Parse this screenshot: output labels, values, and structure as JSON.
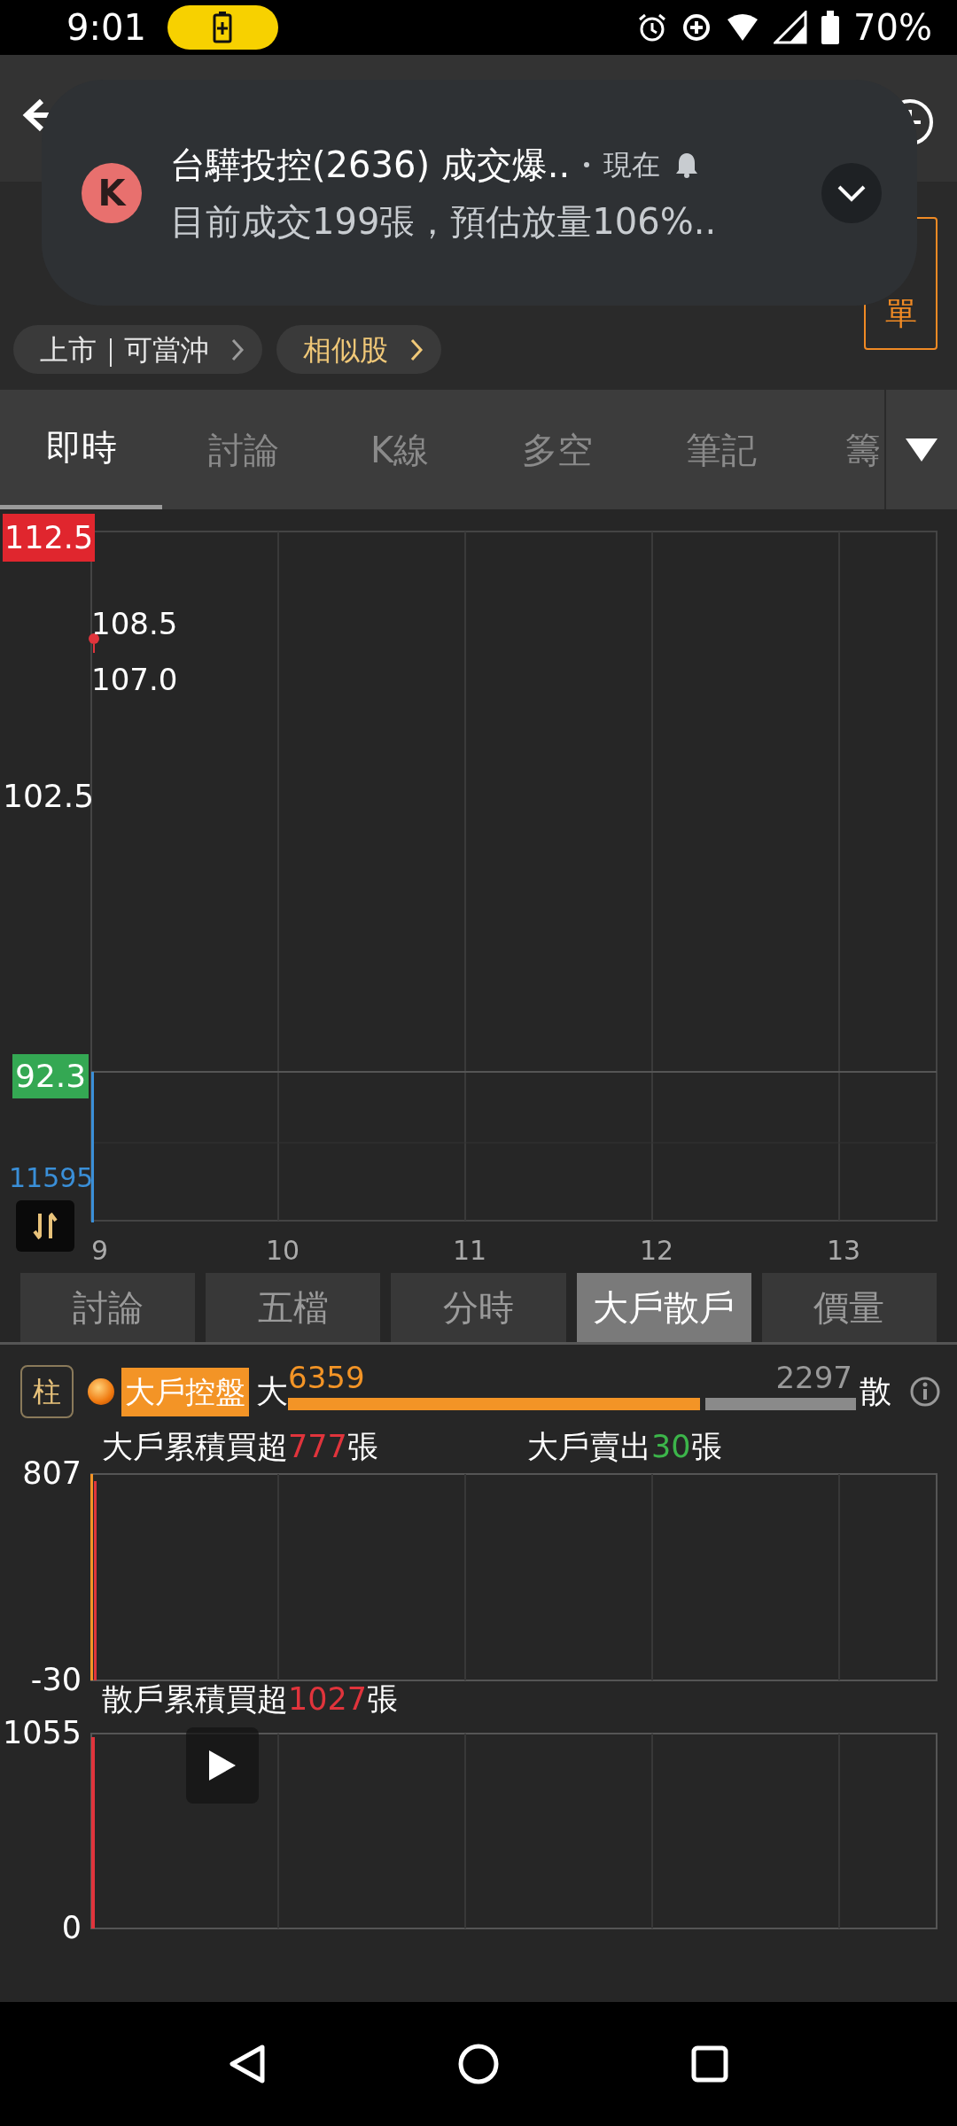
{
  "status_bar": {
    "time": "9:01",
    "battery": "70%"
  },
  "notification": {
    "app_initial": "K",
    "title": "台驊投控(2636) 成交爆..",
    "time": "現在",
    "body": "目前成交199張，預估放量106%.."
  },
  "header": {
    "order_button": "單"
  },
  "chips": [
    {
      "label": "上市｜可當沖",
      "kind": "market"
    },
    {
      "label": "相似股",
      "kind": "similar"
    }
  ],
  "tabs": [
    {
      "label": "即時",
      "selected": true
    },
    {
      "label": "討論",
      "selected": false
    },
    {
      "label": "K線",
      "selected": false
    },
    {
      "label": "多空",
      "selected": false
    },
    {
      "label": "筆記",
      "selected": false
    },
    {
      "label": "籌",
      "selected": false
    }
  ],
  "price_chart": {
    "high": "112.5",
    "last_high": "108.5",
    "last_low": "107.0",
    "mid": "102.5",
    "low": "92.3",
    "volume": "11595",
    "x_labels": [
      "9",
      "10",
      "11",
      "12",
      "13"
    ]
  },
  "sub_tabs": [
    {
      "label": "討論",
      "selected": false
    },
    {
      "label": "五檔",
      "selected": false
    },
    {
      "label": "分時",
      "selected": false
    },
    {
      "label": "大戶散戶",
      "selected": true
    },
    {
      "label": "價量",
      "selected": false
    }
  ],
  "big_small": {
    "mode_button": "柱",
    "label": "大戶控盤",
    "big_label": "大",
    "big_value": "6359",
    "small_value": "2297",
    "small_label": "散",
    "level": 0.735
  },
  "big_chart": {
    "stats": [
      {
        "label": "大戶累積買超",
        "value": "777",
        "unit": "張",
        "color": "#e0343c"
      },
      {
        "label": "大戶賣出",
        "value": "30",
        "unit": "張",
        "color": "#3cb54a"
      }
    ],
    "y_max": "807",
    "y_min": "-30"
  },
  "retail_chart": {
    "stats": [
      {
        "label": "散戶累積買超",
        "value": "1027",
        "unit": "張",
        "color": "#e0343c"
      }
    ],
    "y_max": "1055",
    "y_min": "0"
  }
}
